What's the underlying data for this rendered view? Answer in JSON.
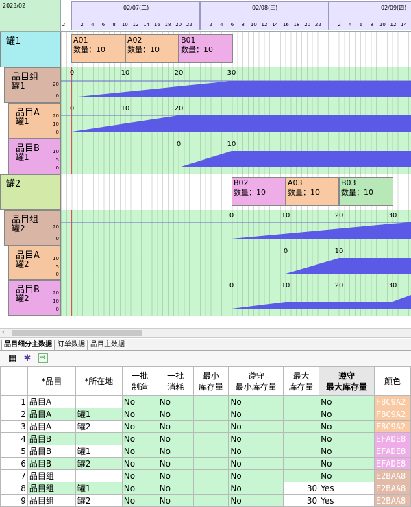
{
  "header": {
    "date": "2023/02",
    "days": [
      "02/07(二)",
      "02/08(三)",
      "02/09(四)"
    ],
    "hours_full": [
      "2",
      "4",
      "6",
      "8",
      "10",
      "12",
      "14",
      "16",
      "18",
      "20",
      "22"
    ],
    "hours_last": [
      "2",
      "4",
      "6",
      "8",
      "10",
      "12",
      "14"
    ],
    "first_hour": "2"
  },
  "rows": {
    "tank1": {
      "label": "罐1",
      "bars": [
        {
          "name": "A01",
          "qty": "数量：10",
          "color": "#F8C9A2"
        },
        {
          "name": "A02",
          "qty": "数量：10",
          "color": "#F8C9A2"
        },
        {
          "name": "B01",
          "qty": "数量：10",
          "color": "#EFADE8"
        }
      ]
    },
    "t1_group": {
      "label1": "品目组",
      "label2": "罐1",
      "axis": [
        "20",
        "0"
      ],
      "markers": [
        "0",
        "10",
        "20",
        "30"
      ]
    },
    "t1_itemA": {
      "label1": "品目A",
      "label2": "罐1",
      "axis": [
        "20",
        "10",
        "0"
      ],
      "markers": [
        "0",
        "10",
        "20"
      ]
    },
    "t1_itemB": {
      "label1": "品目B",
      "label2": "罐1",
      "axis": [
        "10",
        "5",
        "0"
      ],
      "markers": [
        "0",
        "10"
      ]
    },
    "tank2": {
      "label": "罐2",
      "bars": [
        {
          "name": "B02",
          "qty": "数量：10",
          "color": "#EFADE8"
        },
        {
          "name": "A03",
          "qty": "数量：10",
          "color": "#F8C9A2"
        },
        {
          "name": "B03",
          "qty": "数量：10",
          "color": "#B8E8B8"
        }
      ]
    },
    "t2_group": {
      "label1": "品目组",
      "label2": "罐2",
      "axis": [
        "20",
        "0"
      ],
      "markers": [
        "0",
        "10",
        "20",
        "30"
      ]
    },
    "t2_itemA": {
      "label1": "品目A",
      "label2": "罐2",
      "axis": [
        "10",
        "5",
        "0"
      ],
      "markers": [
        "0",
        "10"
      ]
    },
    "t2_itemB": {
      "label1": "品目B",
      "label2": "罐2",
      "axis": [
        "20",
        "10",
        "0"
      ],
      "markers": [
        "0",
        "10",
        "20",
        "30"
      ]
    }
  },
  "tabs": [
    "品目细分主数据",
    "订单数据",
    "品目主数据"
  ],
  "toolbar": {
    "icons": [
      "grid-icon",
      "settings-icon",
      "export-icon"
    ]
  },
  "table": {
    "headers": [
      "*品目",
      "*所在地",
      "一批\n制造",
      "一批\n消耗",
      "最小\n库存量",
      "遵守\n最小库存量",
      "最大\n库存量",
      "遵守\n最大库存量",
      "颜色"
    ],
    "rows": [
      {
        "idx": "1",
        "item": "品目A",
        "loc": "",
        "make": "No",
        "cons": "No",
        "min": "",
        "keepmin": "No",
        "max": "",
        "keepmax": "No",
        "color": "F8C9A2"
      },
      {
        "idx": "2",
        "item": "品目A",
        "loc": "罐1",
        "make": "No",
        "cons": "No",
        "min": "",
        "keepmin": "No",
        "max": "",
        "keepmax": "No",
        "color": "F8C9A2"
      },
      {
        "idx": "3",
        "item": "品目A",
        "loc": "罐2",
        "make": "No",
        "cons": "No",
        "min": "",
        "keepmin": "No",
        "max": "",
        "keepmax": "No",
        "color": "F8C9A2"
      },
      {
        "idx": "4",
        "item": "品目B",
        "loc": "",
        "make": "No",
        "cons": "No",
        "min": "",
        "keepmin": "No",
        "max": "",
        "keepmax": "No",
        "color": "EFADE8"
      },
      {
        "idx": "5",
        "item": "品目B",
        "loc": "罐1",
        "make": "No",
        "cons": "No",
        "min": "",
        "keepmin": "No",
        "max": "",
        "keepmax": "No",
        "color": "EFADE8"
      },
      {
        "idx": "6",
        "item": "品目B",
        "loc": "罐2",
        "make": "No",
        "cons": "No",
        "min": "",
        "keepmin": "No",
        "max": "",
        "keepmax": "No",
        "color": "EFADE8"
      },
      {
        "idx": "7",
        "item": "品目组",
        "loc": "",
        "make": "No",
        "cons": "No",
        "min": "",
        "keepmin": "No",
        "max": "",
        "keepmax": "No",
        "color": "E2BAA8"
      },
      {
        "idx": "8",
        "item": "品目组",
        "loc": "罐1",
        "make": "No",
        "cons": "No",
        "min": "",
        "keepmin": "No",
        "max": "30",
        "keepmax": "Yes",
        "color": "E2BAA8"
      },
      {
        "idx": "9",
        "item": "品目组",
        "loc": "罐2",
        "make": "No",
        "cons": "No",
        "min": "",
        "keepmin": "No",
        "max": "30",
        "keepmax": "Yes",
        "color": "E2BAA8"
      }
    ]
  },
  "colors": {
    "group": "#D9B5A6",
    "itemA": "#F5C6A0",
    "itemB": "#EBA8E6",
    "tank1": "#A8EEF0",
    "tank2": "#D2E9A8",
    "gantt_bg": "#C9F5CF",
    "fill": "#5A5AE6"
  }
}
